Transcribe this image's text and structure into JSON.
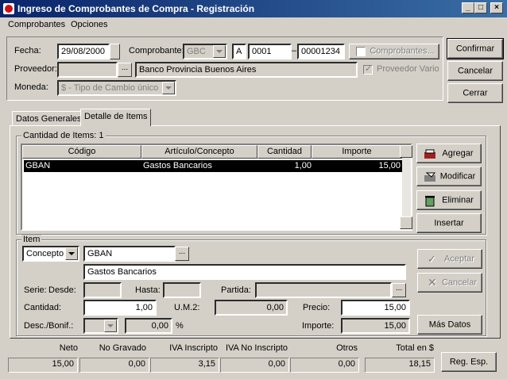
{
  "window": {
    "title": "Ingreso de Comprobantes de Compra - Registración",
    "min": "_",
    "max": "□",
    "close": "×"
  },
  "menu": {
    "items": [
      "Comprobantes",
      "Opciones"
    ]
  },
  "header": {
    "fecha_label": "Fecha:",
    "fecha_value": "29/08/2000",
    "comprobante_label": "Comprobante:",
    "comprobante_tipo": "GBC",
    "comprobante_letra": "A",
    "comprobante_pv": "0001",
    "comprobante_sep": "–",
    "comprobante_num": "00001234",
    "comprobantes_check": "Comprobantes...",
    "proveedor_label": "Proveedor:",
    "proveedor_value": "",
    "proveedor_name": "Banco Provincia Buenos Aires",
    "proveedor_vario": "Proveedor Vario",
    "moneda_label": "Moneda:",
    "moneda_value": "$ - Tipo de Cambio único",
    "dots": "..."
  },
  "buttons": {
    "confirmar": "Confirmar",
    "cancelar": "Cancelar",
    "cerrar": "Cerrar"
  },
  "tabs": [
    "Datos Generales",
    "Detalle de Items"
  ],
  "items_group": {
    "title": "Cantidad de Items: 1",
    "columns": [
      "Código",
      "Artículo/Concepto",
      "Cantidad",
      "Importe"
    ],
    "rows": [
      {
        "codigo": "GBAN",
        "articulo": "Gastos Bancarios",
        "cantidad": "1,00",
        "importe": "15,00"
      }
    ],
    "agregar": "Agregar",
    "modificar": "Modificar",
    "eliminar": "Eliminar",
    "insertar": "Insertar"
  },
  "item_group": {
    "title": "Item",
    "tipo": "Concepto",
    "codigo": "GBAN",
    "descripcion": "Gastos Bancarios",
    "serie_label": "Serie:",
    "desde_label": "Desde:",
    "hasta_label": "Hasta:",
    "partida_label": "Partida:",
    "cantidad_label": "Cantidad:",
    "cantidad_value": "1,00",
    "um2_label": "U.M.2:",
    "um2_value": "0,00",
    "precio_label": "Precio:",
    "precio_value": "15,00",
    "desc_label": "Desc./Bonif.:",
    "desc_value": "0,00",
    "pct": "%",
    "importe_label": "Importe:",
    "importe_value": "15,00",
    "aceptar": "Aceptar",
    "cancelar": "Cancelar",
    "mas_datos": "Más Datos"
  },
  "totals": {
    "labels": [
      "Neto",
      "No Gravado",
      "IVA Inscripto",
      "IVA No Inscripto",
      "Otros",
      "Total en $"
    ],
    "values": [
      "15,00",
      "0,00",
      "3,15",
      "0,00",
      "0,00",
      "18,15"
    ],
    "reg_esp": "Reg. Esp."
  }
}
